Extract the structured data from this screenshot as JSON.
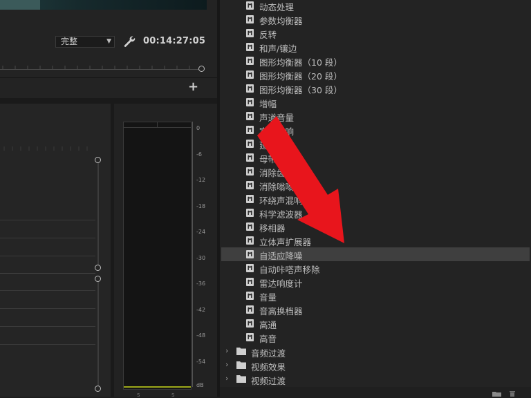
{
  "program_monitor": {
    "quality": "完整",
    "timecode": "00:14:27:05"
  },
  "audio_meter": {
    "scale": [
      "0",
      "-6",
      "-12",
      "-18",
      "-24",
      "-30",
      "-36",
      "-42",
      "-48",
      "-54",
      "dB"
    ],
    "bottom_labels": [
      "S",
      "S"
    ]
  },
  "effects": {
    "items": [
      "动态处理",
      "参数均衡器",
      "反转",
      "和声/镶边",
      "图形均衡器（10 段）",
      "图形均衡器（20 段）",
      "图形均衡器（30 段）",
      "增幅",
      "声道音量",
      "室内混响",
      "延迟",
      "母带处理",
      "消除齿音",
      "消除嗡嗡声",
      "环绕声混响",
      "科学滤波器",
      "移相器",
      "立体声扩展器",
      "自适应降噪",
      "自动咔嗒声移除",
      "雷达响度计",
      "音量",
      "音高换档器",
      "高通",
      "高音"
    ],
    "selected_index": 18,
    "folders": [
      "音频过渡",
      "视频效果",
      "视频过渡"
    ]
  },
  "colors": {
    "annotation_arrow": "#e8151c",
    "meter_level": "#9ea91a",
    "selected_row": "#3f3f3f"
  }
}
